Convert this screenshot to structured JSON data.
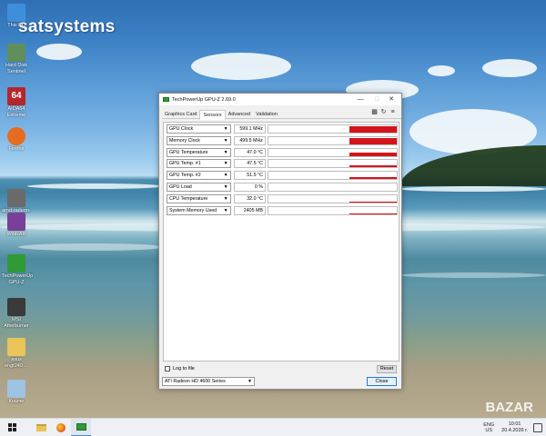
{
  "watermark": "satsystems",
  "watermark_corner": "BAZAR",
  "desktop_icons": [
    {
      "label": "This PC",
      "icon": "this-pc-icon",
      "color": "#3f8edc"
    },
    {
      "label": "Hard Disk Sentinel",
      "icon": "hard-disk-sentinel-icon",
      "color": "#5f8f5a"
    },
    {
      "label": "AIDA64 Extreme",
      "icon": "aida64-icon",
      "glyph": "64",
      "color": "#b5262b"
    },
    {
      "label": "Firefox",
      "icon": "firefox-icon",
      "color": "#e66c1f"
    },
    {
      "label": "amd-radeon-crimson",
      "icon": "radeon-installer-icon",
      "color": "#6a6a6a"
    },
    {
      "label": "WinRAR",
      "icon": "winrar-icon",
      "color": "#7a3f9b"
    },
    {
      "label": "TechPowerUp GPU-Z",
      "icon": "gpu-z-icon",
      "color": "#2f9a36"
    },
    {
      "label": "MSI Afterburner",
      "icon": "msi-afterburner-icon",
      "color": "#3a3a3a"
    },
    {
      "label": "asus engt240 ...",
      "icon": "folder-icon",
      "color": "#e8c45a"
    },
    {
      "label": "Кошче",
      "icon": "recycle-bin-icon",
      "color": "#9fc3e3"
    }
  ],
  "window": {
    "title": "TechPowerUp GPU-Z 2.69.0",
    "tabs": [
      "Graphics Card",
      "Sensors",
      "Advanced",
      "Validation"
    ],
    "active_tab": "Sensors",
    "toolbar_icons": [
      "camera-icon",
      "refresh-icon",
      "menu-icon"
    ],
    "sensors": [
      {
        "name": "GPU Clock",
        "value": "599.1 MHz",
        "level": 0.9
      },
      {
        "name": "Memory Clock",
        "value": "499.5 MHz",
        "level": 0.9
      },
      {
        "name": "GPU Temperature",
        "value": "47.0 °C",
        "level": 0.45
      },
      {
        "name": "GPU Temp. #1",
        "value": "47.5 °C",
        "level": 0.3
      },
      {
        "name": "GPU Temp. #2",
        "value": "51.5 °C",
        "level": 0.3
      },
      {
        "name": "GPU Load",
        "value": "0 %",
        "level": 0
      },
      {
        "name": "CPU Temperature",
        "value": "32.0 °C",
        "level": 0.1
      },
      {
        "name": "System Memory Used",
        "value": "2405 MB",
        "level": 0.15
      }
    ],
    "log_to_file_label": "Log to file",
    "reset_label": "Reset",
    "gpu_selected": "ATI Radeon HD 4600 Series",
    "close_label": "Close"
  },
  "taskbar": {
    "apps": [
      "windows-start-icon",
      "file-explorer-icon",
      "firefox-icon",
      "gpu-z-icon"
    ],
    "lang_top": "ENG",
    "lang_bottom": "US",
    "time": "10:01",
    "date": "20.4.2026 г.",
    "accent": "#4a87d6"
  }
}
